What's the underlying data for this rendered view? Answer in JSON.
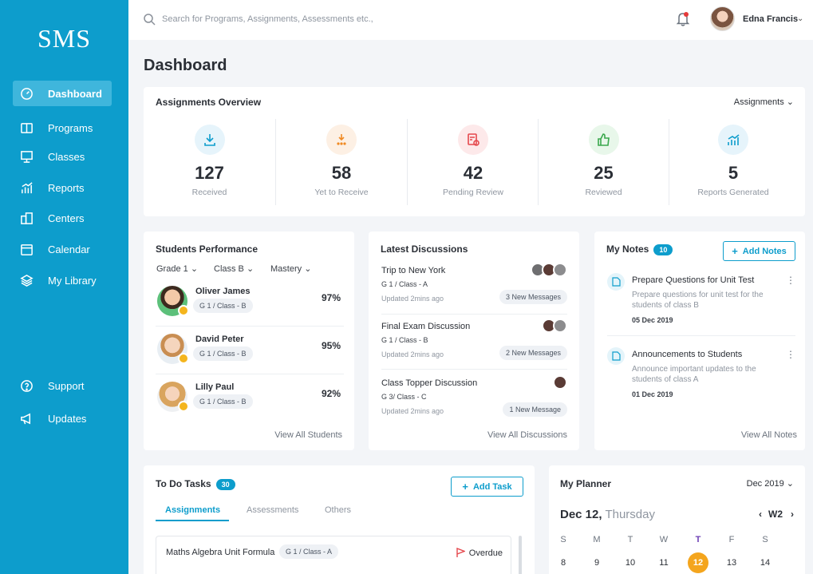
{
  "app": {
    "logo": "SMS"
  },
  "sidebar": {
    "items": [
      {
        "label": "Dashboard",
        "icon": "dashboard-icon"
      },
      {
        "label": "Programs",
        "icon": "book-icon"
      },
      {
        "label": "Classes",
        "icon": "presentation-icon"
      },
      {
        "label": "Reports",
        "icon": "chart-icon"
      },
      {
        "label": "Centers",
        "icon": "building-icon"
      },
      {
        "label": "Calendar",
        "icon": "calendar-icon"
      },
      {
        "label": "My Library",
        "icon": "layers-icon"
      },
      {
        "label": "Support",
        "icon": "help-icon"
      },
      {
        "label": "Updates",
        "icon": "megaphone-icon"
      }
    ]
  },
  "topbar": {
    "search_placeholder": "Search for Programs, Assignments, Assessments etc.,",
    "user_name": "Edna Francis"
  },
  "page": {
    "title": "Dashboard"
  },
  "overview": {
    "title": "Assignments Overview",
    "dropdown": "Assignments",
    "stats": [
      {
        "value": "127",
        "label": "Received",
        "color": "#e6f4fb",
        "icon": "download-icon"
      },
      {
        "value": "58",
        "label": "Yet to Receive",
        "color": "#fdf0e4",
        "icon": "pending-download-icon"
      },
      {
        "value": "42",
        "label": "Pending Review",
        "color": "#fde9ea",
        "icon": "review-icon"
      },
      {
        "value": "25",
        "label": "Reviewed",
        "color": "#e8f7ea",
        "icon": "thumbs-up-icon"
      },
      {
        "value": "5",
        "label": "Reports Generated",
        "color": "#e6f4fb",
        "icon": "report-chart-icon"
      }
    ]
  },
  "performance": {
    "title": "Students Performance",
    "filters": [
      "Grade 1",
      "Class B",
      "Mastery"
    ],
    "students": [
      {
        "name": "Oliver James",
        "class": "G 1 / Class - B",
        "pct": "97%"
      },
      {
        "name": "David Peter",
        "class": "G 1 / Class - B",
        "pct": "95%"
      },
      {
        "name": "Lilly Paul",
        "class": "G 1 / Class - B",
        "pct": "92%"
      }
    ],
    "link": "View All Students"
  },
  "discussions": {
    "title": "Latest Discussions",
    "items": [
      {
        "title": "Trip to New York",
        "class": "G 1 / Class - A",
        "updated": "Updated 2mins ago",
        "messages": "3 New Messages"
      },
      {
        "title": "Final Exam Discussion",
        "class": "G 1 / Class - B",
        "updated": "Updated 2mins ago",
        "messages": "2 New Messages"
      },
      {
        "title": "Class Topper Discussion",
        "class": "G 3/ Class - C",
        "updated": "Updated 2mins ago",
        "messages": "1 New Message"
      }
    ],
    "link": "View All Discussions"
  },
  "notes": {
    "title": "My Notes",
    "count": "10",
    "add_label": "Add Notes",
    "items": [
      {
        "title": "Prepare Questions for Unit Test",
        "desc": "Prepare questions for unit test for the students of class B",
        "date": "05 Dec 2019"
      },
      {
        "title": "Announcements to Students",
        "desc": "Announce important updates to the students of class A",
        "date": "01 Dec 2019"
      }
    ],
    "link": "View All Notes"
  },
  "todo": {
    "title": "To Do Tasks",
    "count": "30",
    "add_label": "Add Task",
    "tabs": [
      "Assignments",
      "Assessments",
      "Others"
    ],
    "task": {
      "name": "Maths Algebra Unit Formula",
      "class": "G 1 / Class - A",
      "status": "Overdue"
    }
  },
  "planner": {
    "title": "My Planner",
    "month": "Dec 2019",
    "date": "Dec 12,",
    "weekday": "Thursday",
    "week": "W2",
    "days": [
      "S",
      "M",
      "T",
      "W",
      "T",
      "F",
      "S"
    ],
    "dates": [
      "8",
      "9",
      "10",
      "11",
      "12",
      "13",
      "14"
    ]
  }
}
